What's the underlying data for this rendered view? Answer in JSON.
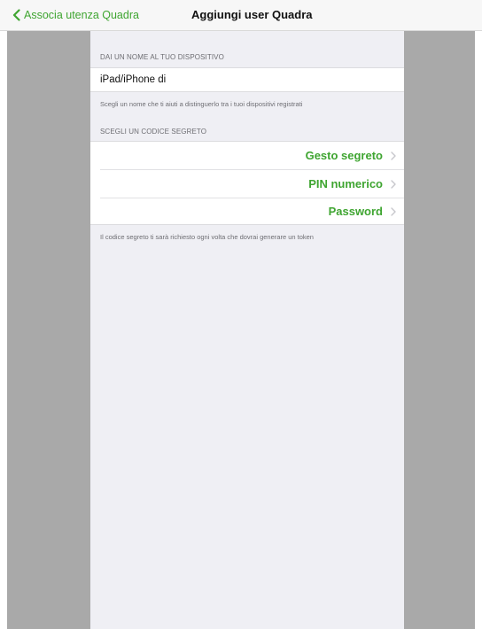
{
  "nav": {
    "back_label": "Associa utenza Quadra",
    "title": "Aggiungi user Quadra"
  },
  "device_section": {
    "header": "DAI UN NOME AL TUO DISPOSITIVO",
    "name_value": "iPad/iPhone di",
    "footer": "Scegli un nome che ti aiuti a distinguerlo tra i tuoi dispositivi registrati"
  },
  "code_section": {
    "header": "SCEGLI UN CODICE SEGRETO",
    "options": [
      {
        "label": "Gesto segreto"
      },
      {
        "label": "PIN numerico"
      },
      {
        "label": "Password"
      }
    ],
    "footer": "Il codice segreto ti sarà richiesto ogni volta che dovrai generare un token"
  },
  "icons": {
    "back": "chevron-left-icon",
    "row_disclosure": "chevron-right-icon"
  },
  "colors": {
    "accent": "#3fa531",
    "background": "#efeff4",
    "side_panel": "#a9a9a9",
    "secondary_text": "#6d6d72"
  }
}
